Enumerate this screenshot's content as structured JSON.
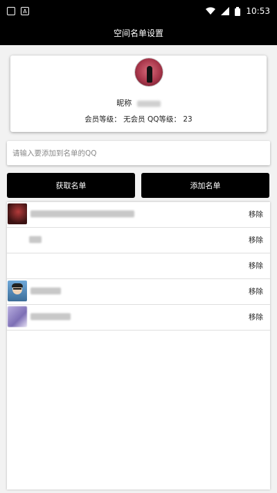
{
  "status_bar": {
    "time": "10:53",
    "notif_left": "▣",
    "notif_right": "A"
  },
  "header": {
    "title": "空间名单设置"
  },
  "profile": {
    "nick_label": "昵称",
    "member_level_label": "会员等级：",
    "member_level_value": "无会员",
    "qq_level_label": "QQ等级：",
    "qq_level_value": "23"
  },
  "input": {
    "placeholder": "请输入要添加到名单的QQ",
    "value": ""
  },
  "buttons": {
    "fetch_label": "获取名单",
    "add_label": "添加名单"
  },
  "list": {
    "remove_label": "移除",
    "items": [
      {
        "avatar": "red-avatar",
        "has_avatar": true
      },
      {
        "avatar": "none",
        "has_avatar": false
      },
      {
        "avatar": "none",
        "has_avatar": false
      },
      {
        "avatar": "cartoon-glasses-avatar",
        "has_avatar": true
      },
      {
        "avatar": "purple-avatar",
        "has_avatar": true
      }
    ]
  },
  "colors": {
    "bar_bg": "#000000",
    "button_bg": "#000000",
    "page_bg": "#f2f2f2"
  }
}
